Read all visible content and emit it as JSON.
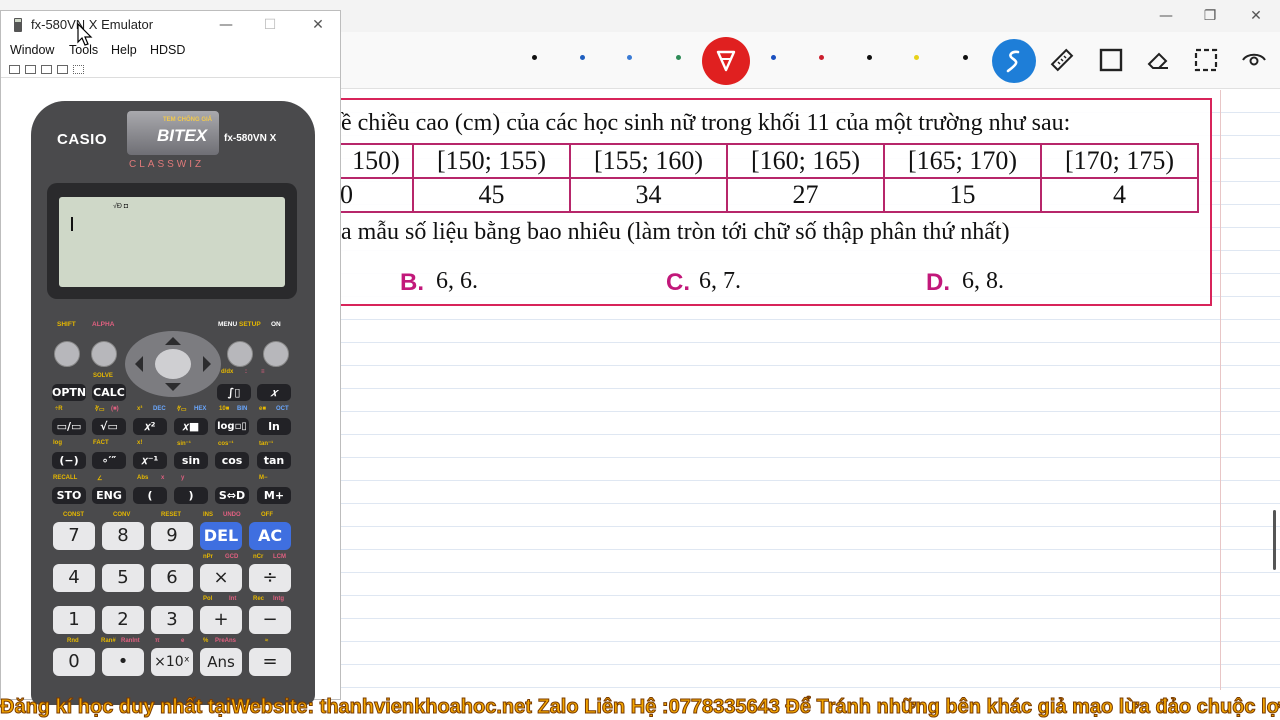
{
  "whiteboard": {
    "window_controls": [
      "—",
      "❐",
      "✕"
    ],
    "tool_dot_colors": [
      "#111111",
      "#1f5fbf",
      "#3a7bd5",
      "#2e8b57",
      "#1a4fbf",
      "#cc1f2e",
      "#111111",
      "#e8d21a",
      "#111111"
    ],
    "active_pen_color": "#e02020",
    "tools": [
      "pen-icon",
      "pen-icon",
      "lasso-icon",
      "ruler-icon",
      "rectangle-icon",
      "eraser-icon",
      "selection-icon",
      "view-icon"
    ]
  },
  "question": {
    "line1": "ề chiều cao (cm) của các học sinh nữ trong khối 11 của một trường như sau:",
    "table": {
      "row1": [
        "150)",
        "[150; 155)",
        "[155; 160)",
        "[160; 165)",
        "[165; 170)",
        "[170; 175)"
      ],
      "row2": [
        "0",
        "45",
        "34",
        "27",
        "15",
        "4"
      ]
    },
    "line2": "a mẫu số liệu bằng bao nhiêu (làm tròn tới chữ số thập phân thứ nhất)",
    "options": [
      {
        "letter": "B.",
        "value": "6, 6."
      },
      {
        "letter": "C.",
        "value": "6, 7."
      },
      {
        "letter": "D.",
        "value": "6, 8."
      }
    ]
  },
  "emulator": {
    "title": "fx-580VN X Emulator",
    "window_controls": [
      "—",
      "☐",
      "✕"
    ],
    "menu": [
      "Window",
      "Tools",
      "Help",
      "HDSD"
    ],
    "calculator": {
      "brand": "CASIO",
      "badge_small": "TEM CHỐNG GIẢ",
      "badge": "BITEX",
      "model": "fx-580VN X",
      "series": "CLASSWIZ",
      "lcd_indicator": "√Ð ◘",
      "top_labels": {
        "shift": "SHIFT",
        "alpha": "ALPHA",
        "menu": "MENU",
        "setup": "SETUP",
        "on": "ON"
      },
      "func_rows": [
        [
          "OPTN",
          "CALC",
          "∫▯",
          "𝑥"
        ],
        [
          "▭/▭",
          "√▭",
          "𝑥²",
          "𝑥■",
          "log▫▯",
          "ln"
        ],
        [
          "(−)",
          "∘′″",
          "𝑥⁻¹",
          "sin",
          "cos",
          "tan"
        ],
        [
          "STO",
          "ENG",
          "(",
          ")",
          "S⇔D",
          "M+"
        ]
      ],
      "func_labels": {
        "row0": [
          "SOLVE",
          "d/dx",
          ":",
          "≡"
        ],
        "row1": [
          "÷R",
          "∛▭",
          "(■)",
          "DEC",
          "x³",
          "∜▭",
          "HEX",
          "10■",
          "BIN",
          "e■",
          "OCT"
        ],
        "row2": [
          "log",
          "FACT",
          "x!",
          "sin⁻¹",
          "cos⁻¹",
          "tan⁻¹"
        ],
        "row3": [
          "RECALL",
          "∠",
          "Abs",
          "x",
          "y",
          "M−"
        ]
      },
      "num_rows": [
        [
          "7",
          "8",
          "9",
          "DEL",
          "AC"
        ],
        [
          "4",
          "5",
          "6",
          "×",
          "÷"
        ],
        [
          "1",
          "2",
          "3",
          "+",
          "−"
        ],
        [
          "0",
          "•",
          "×10ˣ",
          "Ans",
          "="
        ]
      ],
      "num_labels": {
        "row1": [
          "CONST",
          "CONV",
          "RESET",
          "INS",
          "UNDO",
          "OFF"
        ],
        "row2": [
          "nPr",
          "GCD",
          "nCr",
          "LCM"
        ],
        "row3": [
          "Pol",
          "Int",
          "Rec",
          "Intg"
        ],
        "row4": [
          "Rnd",
          "Ran#",
          "RanInt",
          "π",
          "e",
          "%",
          "PreAns",
          "≈"
        ]
      }
    }
  },
  "banner": "Đăng kí học duy nhất tạiWebsite: thanhvienkhoahoc.net  Zalo Liên Hệ :0778335643 Để Tránh những bên khác giả mạo lừa đảo chuộc lợi"
}
